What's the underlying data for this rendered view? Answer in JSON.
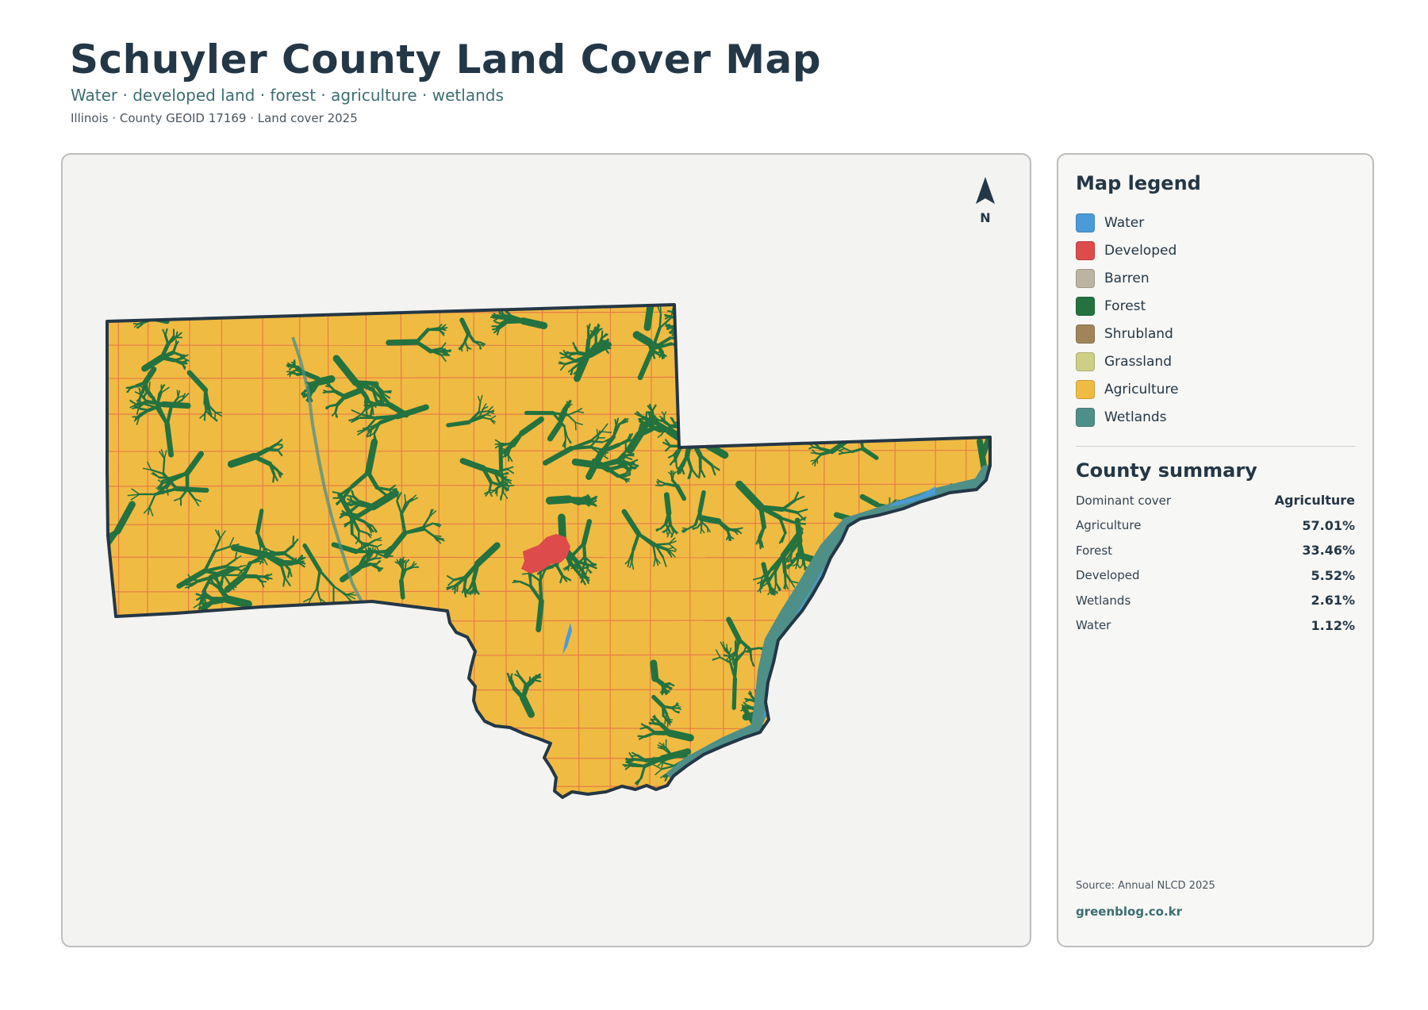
{
  "title": "Schuyler County Land Cover Map",
  "subtitle": "Water · developed land · forest · agriculture · wetlands",
  "meta": "Illinois · County GEOID 17169 · Land cover 2025",
  "map": {
    "north_label": "N",
    "colors": {
      "background": "#f3f3f1",
      "outline": "#243746",
      "agriculture": "#f0bb42",
      "forest": "#23723f",
      "developed": "#dd4b4b",
      "water": "#4a9bd8",
      "wetlands": "#4e8f88"
    }
  },
  "legend": {
    "heading": "Map legend",
    "items": [
      {
        "label": "Water",
        "color": "#4a9bd8"
      },
      {
        "label": "Developed",
        "color": "#dd4b4b"
      },
      {
        "label": "Barren",
        "color": "#bcb4a2"
      },
      {
        "label": "Forest",
        "color": "#23723f"
      },
      {
        "label": "Shrubland",
        "color": "#a0855a"
      },
      {
        "label": "Grassland",
        "color": "#cccf85"
      },
      {
        "label": "Agriculture",
        "color": "#f0bb42"
      },
      {
        "label": "Wetlands",
        "color": "#4e8f88"
      }
    ]
  },
  "summary": {
    "heading": "County summary",
    "rows": [
      {
        "key": "Dominant cover",
        "value": "Agriculture"
      },
      {
        "key": "Agriculture",
        "value": "57.01%"
      },
      {
        "key": "Forest",
        "value": "33.46%"
      },
      {
        "key": "Developed",
        "value": "5.52%"
      },
      {
        "key": "Wetlands",
        "value": "2.61%"
      },
      {
        "key": "Water",
        "value": "1.12%"
      }
    ]
  },
  "source": "Source: Annual NLCD 2025",
  "site": "greenblog.co.kr"
}
